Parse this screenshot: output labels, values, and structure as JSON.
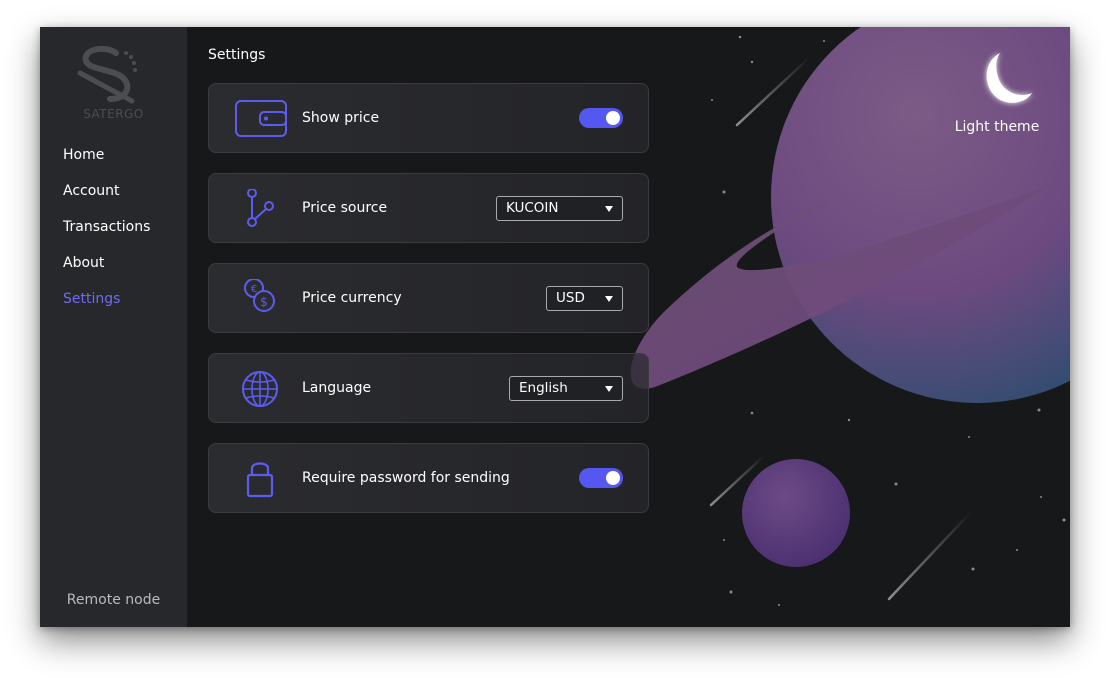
{
  "brand": {
    "name": "SATERGO"
  },
  "nav": {
    "items": [
      {
        "label": "Home",
        "active": false
      },
      {
        "label": "Account",
        "active": false
      },
      {
        "label": "Transactions",
        "active": false
      },
      {
        "label": "About",
        "active": false
      },
      {
        "label": "Settings",
        "active": true
      }
    ],
    "remote_node_label": "Remote node"
  },
  "page": {
    "title": "Settings"
  },
  "theme_toggle": {
    "label": "Light theme",
    "icon": "moon-icon"
  },
  "settings": {
    "show_price": {
      "label": "Show price",
      "icon": "wallet-icon",
      "enabled": true
    },
    "price_source": {
      "label": "Price source",
      "icon": "branch-icon",
      "selected": "KUCOIN"
    },
    "price_currency": {
      "label": "Price currency",
      "icon": "currency-exchange-icon",
      "selected": "USD"
    },
    "language": {
      "label": "Language",
      "icon": "globe-icon",
      "selected": "English"
    },
    "require_password": {
      "label": "Require password for sending",
      "icon": "lock-icon",
      "enabled": true
    }
  },
  "colors": {
    "accent": "#5457f0",
    "active_nav": "#6e6cf2",
    "sidebar_bg": "#27282b",
    "content_bg": "#17181a",
    "planet": "#7a4f88"
  }
}
